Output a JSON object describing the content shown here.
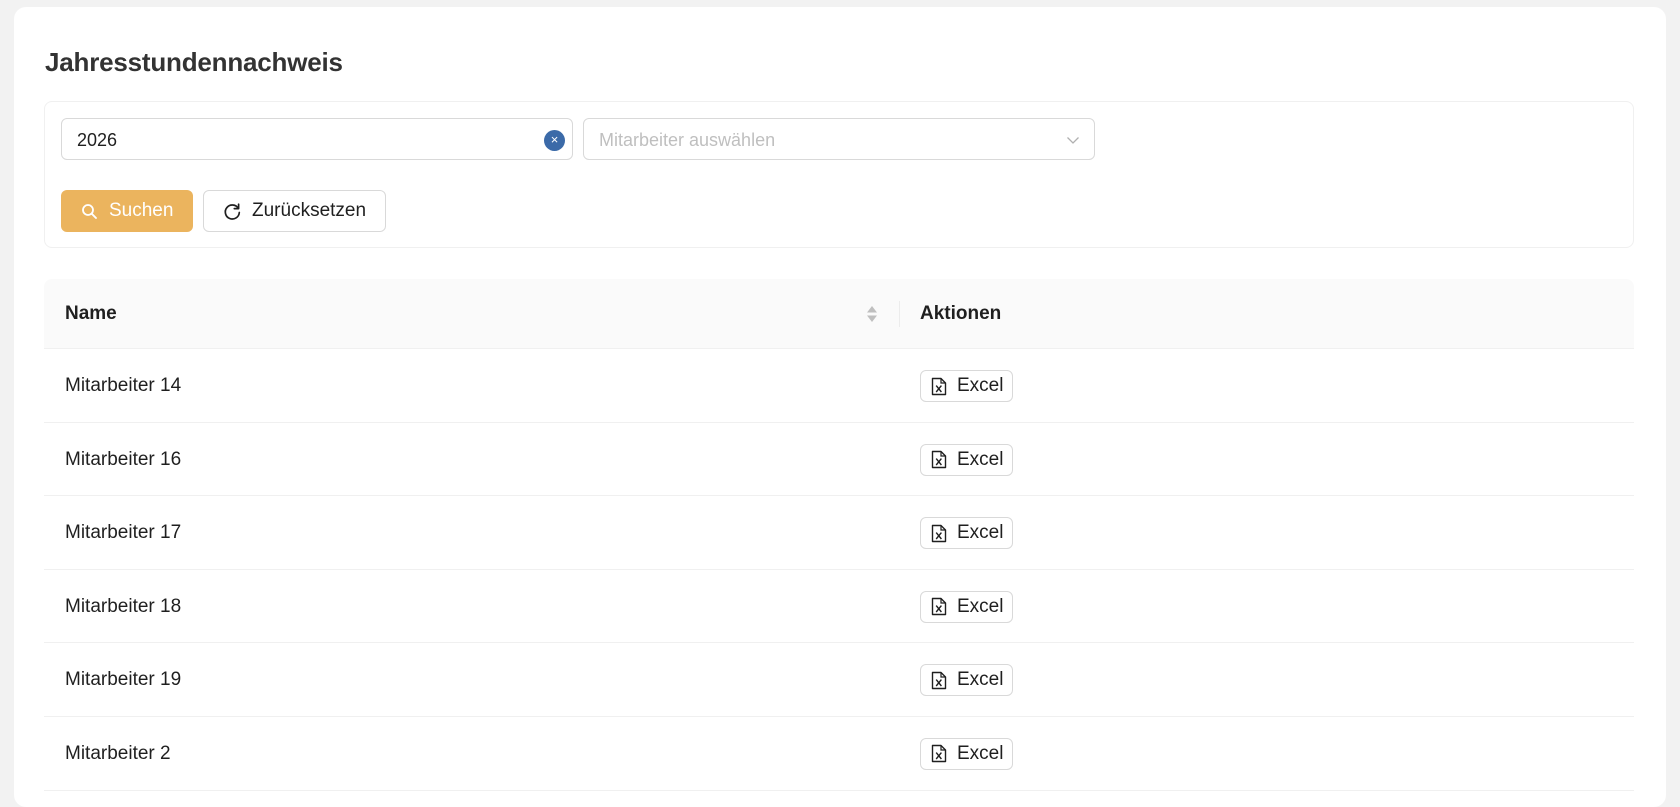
{
  "page": {
    "title": "Jahresstundennachweis"
  },
  "filters": {
    "year_value": "2026",
    "clear_glyph": "×",
    "employee_placeholder": "Mitarbeiter auswählen",
    "search_label": "Suchen",
    "reset_label": "Zurücksetzen"
  },
  "table": {
    "columns": {
      "name": "Name",
      "actions": "Aktionen"
    },
    "action_label": "Excel",
    "rows": [
      {
        "name": "Mitarbeiter 14"
      },
      {
        "name": "Mitarbeiter 16"
      },
      {
        "name": "Mitarbeiter 17"
      },
      {
        "name": "Mitarbeiter 18"
      },
      {
        "name": "Mitarbeiter 19"
      },
      {
        "name": "Mitarbeiter 2"
      }
    ]
  },
  "icons": {
    "search": "search-icon",
    "reset": "reload-icon",
    "excel": "file-excel-icon",
    "select": "chevron-down-icon",
    "sort": "sort-icon"
  },
  "colors": {
    "primary_button": "#ebb45e",
    "clear_badge": "#3b6aa8",
    "background": "#f2f2f2"
  }
}
